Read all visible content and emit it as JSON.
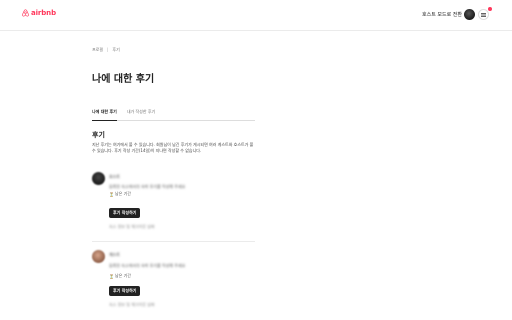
{
  "header": {
    "logo_text": "airbnb",
    "host_link": "호스트 모드로 전환"
  },
  "breadcrumb": {
    "items": [
      "프로필",
      "후기"
    ]
  },
  "page_title": "나에 대한 후기",
  "tabs": [
    {
      "label": "나에 대한 후기",
      "active": true
    },
    {
      "label": "내가 작성한 후기",
      "active": false
    }
  ],
  "section": {
    "title": "후기",
    "description": "지난 후기는 여기에서 볼 수 있습니다. 회원님이 남긴 후기가 게시되면 여러 게스트와 호스트가 볼 수 있습니다. 후기 작성 기간(14일)이 지나면 작성할 수 없습니다."
  },
  "reviews": [
    {
      "name": "호스트",
      "text": "등록된 숙소에서의 숙박 후기를 작성해 주세요",
      "status": "남은 기간",
      "button_label": "후기 작성하기",
      "footer": "숙소 정보 및 체크아웃 날짜"
    },
    {
      "name": "게스트",
      "text": "등록된 숙소에서의 숙박 후기를 작성해 주세요",
      "status": "남은 기간",
      "button_label": "후기 작성하기",
      "footer": "숙소 정보 및 체크아웃 날짜"
    }
  ],
  "colors": {
    "brand": "#ff385c",
    "text": "#222222",
    "button": "#222222"
  }
}
